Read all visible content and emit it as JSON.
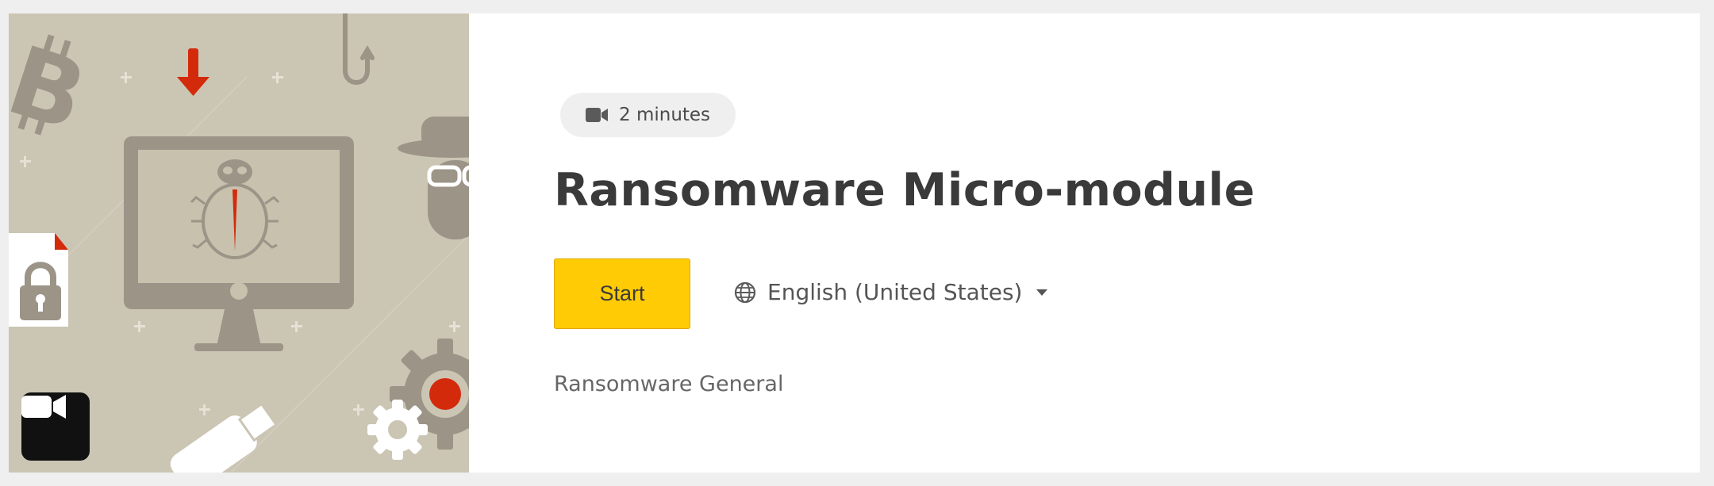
{
  "course": {
    "duration": "2 minutes",
    "title": "Ransomware Micro-module",
    "start_label": "Start",
    "language": "English (United States)",
    "category": "Ransomware General"
  },
  "icons": {
    "duration": "video-camera-icon",
    "language": "globe-icon",
    "language_dropdown": "caret-down-icon",
    "thumbnail_badge": "video-camera-icon"
  },
  "colors": {
    "thumbnail_bg": "#cbc5b4",
    "illustration": "#9b9487",
    "accent_red": "#d32a0c",
    "start_button": "#ffcb05",
    "title_text": "#3a3a3a"
  }
}
